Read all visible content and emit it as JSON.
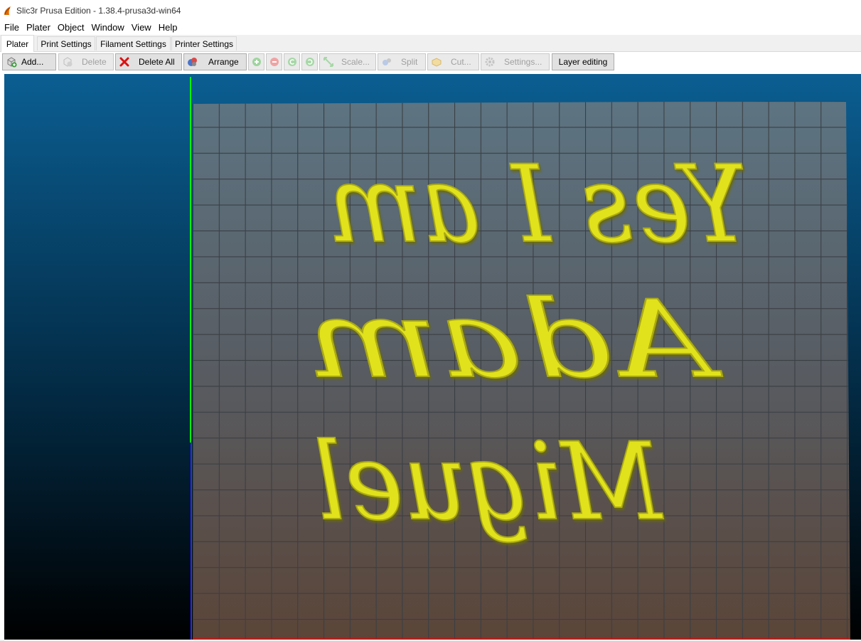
{
  "window": {
    "title": "Slic3r Prusa Edition - 1.38.4-prusa3d-win64",
    "app_icon": "slic3r-logo-icon"
  },
  "menubar": {
    "items": [
      "File",
      "Plater",
      "Object",
      "Window",
      "View",
      "Help"
    ]
  },
  "tabs": [
    {
      "label": "Plater",
      "active": true
    },
    {
      "label": "Print Settings",
      "active": false
    },
    {
      "label": "Filament Settings",
      "active": false
    },
    {
      "label": "Printer Settings",
      "active": false
    }
  ],
  "toolbar": {
    "add": {
      "label": "Add...",
      "icon": "add-object-icon",
      "enabled": true
    },
    "delete": {
      "label": "Delete",
      "icon": "delete-icon",
      "enabled": false
    },
    "delete_all": {
      "label": "Delete All",
      "icon": "red-x-icon",
      "enabled": true
    },
    "arrange": {
      "label": "Arrange",
      "icon": "arrange-icon",
      "enabled": true
    },
    "increase": {
      "icon": "plus-icon",
      "enabled": false
    },
    "decrease": {
      "icon": "minus-icon",
      "enabled": false
    },
    "rotate_ccw": {
      "icon": "rotate-ccw-icon",
      "enabled": false
    },
    "rotate_cw": {
      "icon": "rotate-cw-icon",
      "enabled": false
    },
    "scale": {
      "label": "Scale...",
      "icon": "scale-icon",
      "enabled": false
    },
    "split": {
      "label": "Split",
      "icon": "split-icon",
      "enabled": false
    },
    "cut": {
      "label": "Cut...",
      "icon": "cut-icon",
      "enabled": false
    },
    "settings": {
      "label": "Settings...",
      "icon": "gear-icon",
      "enabled": false
    },
    "layer_editing": {
      "label": "Layer editing",
      "enabled": true
    }
  },
  "viewport": {
    "model_lines": [
      "Yes I am",
      "Adam",
      "Miguel"
    ],
    "model_color": "#e6e61a",
    "bed_top_color": "#5b7381",
    "bed_bottom_color": "#5a4639",
    "background_top": "#0a5a8c",
    "background_bottom": "#000000",
    "axis_x_color": "#ff0000",
    "axis_y_color": "#00ff00",
    "axis_z_color": "#0000ff"
  }
}
